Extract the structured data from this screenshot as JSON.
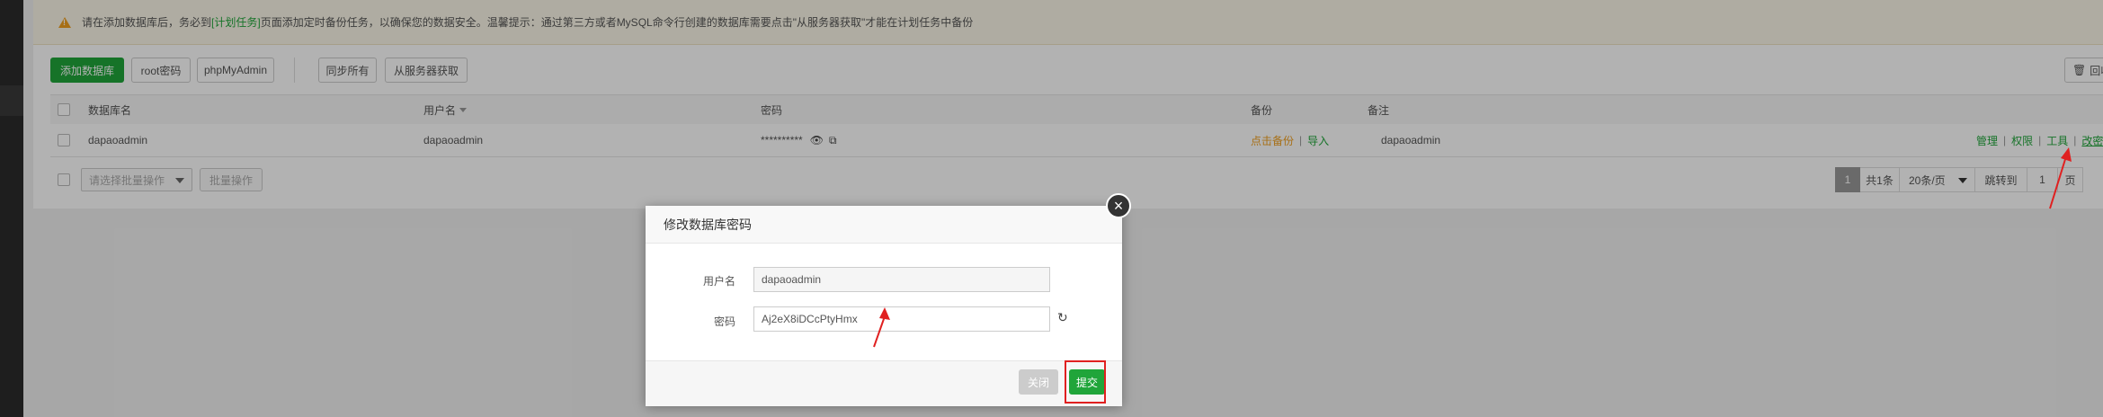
{
  "notice": {
    "before": "请在添加数据库后，务必到",
    "link": "[计划任务]",
    "after": "页面添加定时备份任务，以确保您的数据安全。温馨提示：通过第三方或者MySQL命令行创建的数据库需要点击\"从服务器获取\"才能在计划任务中备份"
  },
  "toolbar": {
    "add_db": "添加数据库",
    "root_pwd": "root密码",
    "phpmyadmin": "phpMyAdmin",
    "sync_all": "同步所有",
    "from_server": "从服务器获取",
    "recycle": "回收站"
  },
  "table": {
    "headers": {
      "name": "数据库名",
      "user": "用户名",
      "password": "密码",
      "backup": "备份",
      "remark": "备注"
    },
    "rows": [
      {
        "name": "dapaoadmin",
        "user": "dapaoadmin",
        "password": "**********",
        "backup_action": "点击备份",
        "import_action": "导入",
        "remark": "dapaoadmin",
        "actions": [
          "管理",
          "权限",
          "工具",
          "改密"
        ]
      }
    ]
  },
  "footer": {
    "batch_select_placeholder": "请选择批量操作",
    "batch_button": "批量操作"
  },
  "pager": {
    "current": "1",
    "total": "共1条",
    "page_size": "20条/页",
    "jump_label": "跳转到",
    "jump_value": "1",
    "page_unit": "页"
  },
  "dialog": {
    "title": "修改数据库密码",
    "username_label": "用户名",
    "username_value": "dapaoadmin",
    "password_label": "密码",
    "password_value": "Aj2eX8iDCcPtyHmx",
    "close_button": "关闭",
    "submit_button": "提交"
  },
  "colors": {
    "accent": "#20a53a",
    "warning": "#f0a020",
    "annotation": "#e02020"
  }
}
